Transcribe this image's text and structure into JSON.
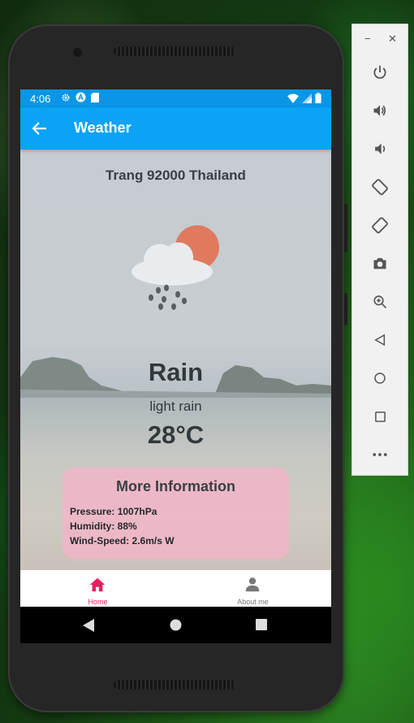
{
  "status_bar": {
    "time": "4:06"
  },
  "app_bar": {
    "title": "Weather"
  },
  "weather": {
    "location": "Trang 92000 Thailand",
    "condition": "Rain",
    "description": "light rain",
    "temperature": "28°C"
  },
  "more_info": {
    "title": "More Information",
    "pressure": "Pressure: 1007hPa",
    "humidity": "Humidity: 88%",
    "wind": "Wind-Speed: 2.6m/s W"
  },
  "bottom_nav": {
    "items": [
      {
        "label": "Home",
        "icon": "home-icon",
        "active": true
      },
      {
        "label": "About me",
        "icon": "person-icon",
        "active": false
      }
    ]
  },
  "colors": {
    "accent": "#0aa3f5",
    "active_nav": "#e91e63",
    "inactive_nav": "#777777",
    "card": "#f5b4c8"
  },
  "emulator_panel": {
    "buttons": [
      "power-icon",
      "volume-up-icon",
      "volume-down-icon",
      "rotate-left-icon",
      "rotate-right-icon",
      "camera-icon",
      "zoom-icon",
      "back-icon",
      "home-icon",
      "overview-icon",
      "more-icon"
    ]
  }
}
